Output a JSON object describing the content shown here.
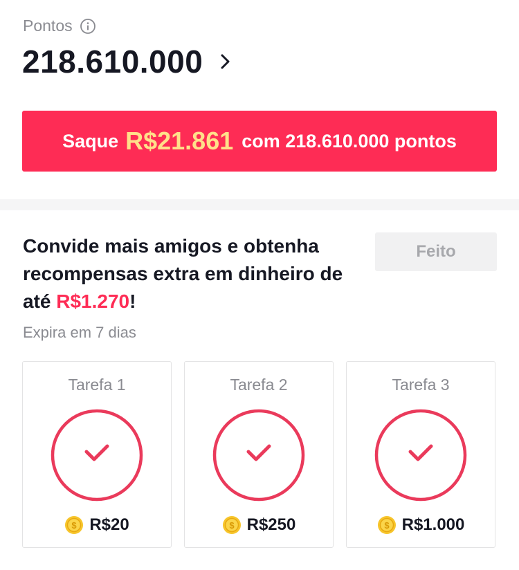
{
  "points": {
    "label": "Pontos",
    "value": "218.610.000"
  },
  "withdraw": {
    "prefix": "Saque",
    "amount": "R$21.861",
    "suffix": "com 218.610.000 pontos"
  },
  "invite": {
    "title_part1": "Convide mais amigos e obtenha recompensas extra em dinheiro de até ",
    "title_amount": "R$1.270",
    "title_end": "!",
    "done_label": "Feito",
    "expires": "Expira em 7 dias"
  },
  "tasks": [
    {
      "title": "Tarefa 1",
      "reward": "R$20",
      "completed": true
    },
    {
      "title": "Tarefa 2",
      "reward": "R$250",
      "completed": true
    },
    {
      "title": "Tarefa 3",
      "reward": "R$1.000",
      "completed": true
    }
  ],
  "colors": {
    "accent": "#fe2c55",
    "amount_highlight": "#ffe08a",
    "coin": "#f7c52b"
  },
  "icons": {
    "info": "info-icon",
    "chevron": "chevron-right-icon",
    "check": "check-icon",
    "coin": "coin-icon"
  }
}
